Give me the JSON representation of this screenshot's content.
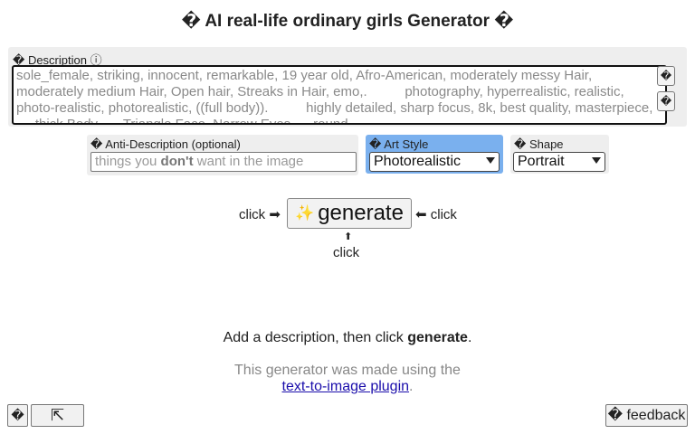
{
  "title": "� AI real-life ordinary girls Generator �",
  "description": {
    "label": "� Description",
    "info_icon": "ⓘ",
    "text": "sole_female, striking, innocent, remarkable, 19 year old, Afro-American, moderately messy Hair, moderately medium Hair, Open hair, Streaks in Hair, emo,.          photography, hyperrealistic, realistic, photo-realistic, photorealistic, ((full body)).          highly detailed, sharp focus, 8k, best quality, masterpiece, ..., thick Body, ..., Triangle Face, Narrow Eyes, ... round",
    "side_button_1": "�",
    "side_button_2": "�"
  },
  "anti_description": {
    "label": "� Anti-Description (optional)",
    "placeholder_before": "things you ",
    "placeholder_bold": "don't",
    "placeholder_after": " want in the image"
  },
  "art_style": {
    "label": "� Art Style",
    "selected": "Photorealistic"
  },
  "shape": {
    "label": "� Shape",
    "selected": "Portrait"
  },
  "generate": {
    "click_left": "click ➡",
    "button_icon": "✨",
    "button_label": "generate",
    "click_right": "⬅ click",
    "up_arrow": "⬆",
    "click_below": "click"
  },
  "hint": {
    "prefix": "Add a description, then click ",
    "bold": "generate",
    "suffix": "."
  },
  "footer": {
    "made_using": "This generator was made using the",
    "plugin_link": "text-to-image plugin",
    "period": ".",
    "left_button_1": "�",
    "left_button_2": "⇱",
    "feedback": "� feedback"
  }
}
